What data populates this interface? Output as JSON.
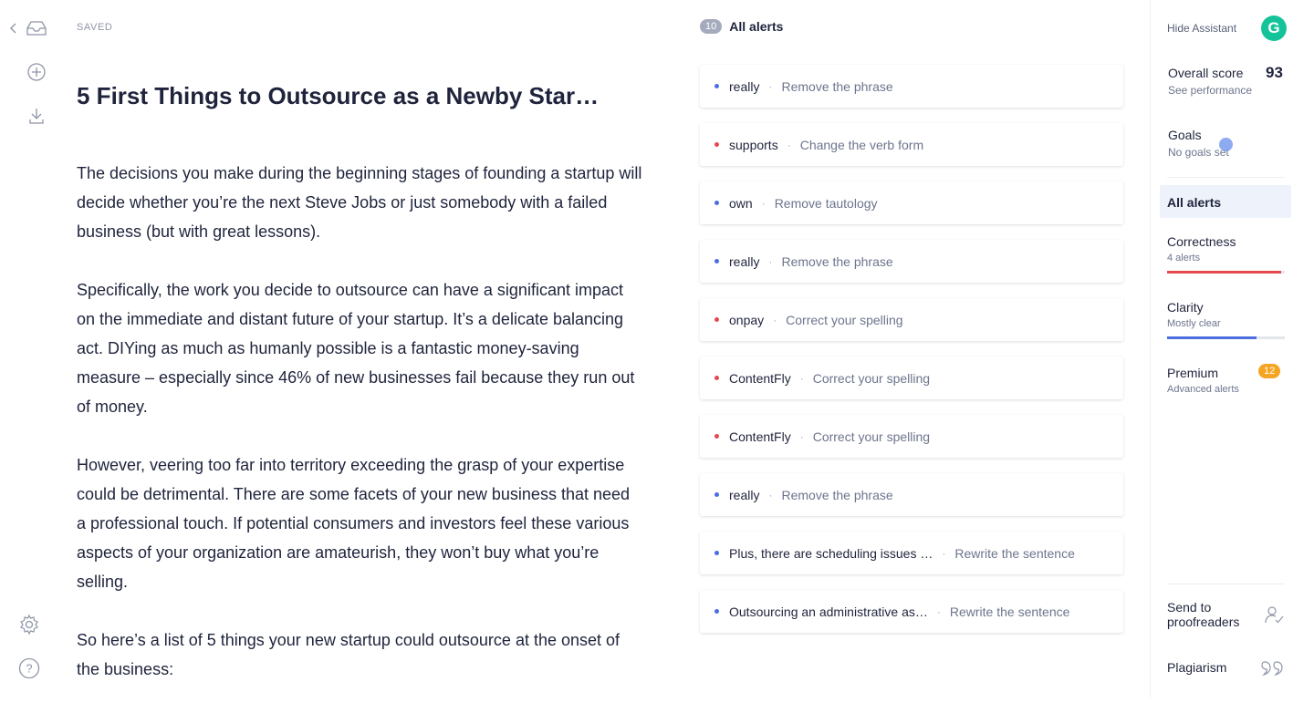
{
  "toolbar": {
    "icons": [
      "chevron-left-icon",
      "inbox-icon",
      "plus-circle-icon",
      "download-icon",
      "gear-icon",
      "help-icon"
    ]
  },
  "editor": {
    "status": "SAVED",
    "title": "5 First Things to Outsource as a Newby Star…",
    "paragraphs": [
      "The decisions you make during the beginning stages of founding a startup will decide whether you’re the next Steve Jobs or just somebody with a failed business (but with great lessons).",
      "Specifically, the work you decide to outsource can have a significant impact on the immediate and distant future of your startup. It’s a delicate balancing act. DIYing as much as humanly possible is a fantastic money-saving measure – especially since 46% of new businesses fail because they run out of money.",
      "However, veering too far into territory exceeding the grasp of your expertise could be detrimental. There are some facets of your new business that need a professional touch. If potential consumers and investors feel these various aspects of your organization are amateurish, they won’t buy what you’re selling.",
      "So here’s a list of 5 things your new startup could outsource at the onset of the business:"
    ]
  },
  "alerts": {
    "count": "10",
    "title": "All alerts",
    "items": [
      {
        "word": "really",
        "hint": "Remove the phrase",
        "color": "#4a6ee0"
      },
      {
        "word": "supports",
        "hint": "Change the verb form",
        "color": "#e5484d"
      },
      {
        "word": "own",
        "hint": "Remove tautology",
        "color": "#4a6ee0"
      },
      {
        "word": "really",
        "hint": "Remove the phrase",
        "color": "#4a6ee0"
      },
      {
        "word": "onpay",
        "hint": "Correct your spelling",
        "color": "#e5484d"
      },
      {
        "word": "ContentFly",
        "hint": "Correct your spelling",
        "color": "#e5484d"
      },
      {
        "word": "ContentFly",
        "hint": "Correct your spelling",
        "color": "#e5484d"
      },
      {
        "word": "really",
        "hint": "Remove the phrase",
        "color": "#4a6ee0"
      },
      {
        "word": "Plus, there are scheduling issues …",
        "hint": "Rewrite the sentence",
        "color": "#4a6ee0"
      },
      {
        "word": "Outsourcing an administrative as…",
        "hint": "Rewrite the sentence",
        "color": "#4a6ee0"
      }
    ]
  },
  "sidebar": {
    "hide_assistant": "Hide Assistant",
    "logo_letter": "G",
    "brand_color": "#15c39a",
    "overall_score_label": "Overall score",
    "overall_score_value": "93",
    "see_performance": "See performance",
    "goals_label": "Goals",
    "goals_sub": "No goals set",
    "all_alerts": "All alerts",
    "categories": [
      {
        "name": "Correctness",
        "sub": "4 alerts",
        "color": "#e5484d",
        "progress": 0.97
      },
      {
        "name": "Clarity",
        "sub": "Mostly clear",
        "color": "#4a6ee0",
        "progress": 0.76
      }
    ],
    "premium": {
      "name": "Premium",
      "sub": "Advanced alerts",
      "badge": "12",
      "badge_color": "#f5a524"
    },
    "send_to_proofreaders": "Send to proofreaders",
    "plagiarism": "Plagiarism"
  }
}
